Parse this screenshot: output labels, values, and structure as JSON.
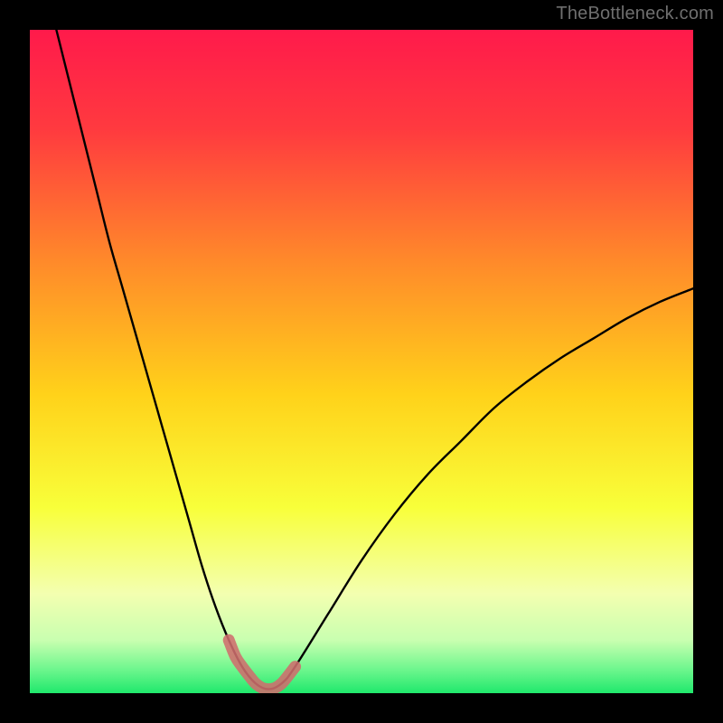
{
  "watermark": "TheBottleneck.com",
  "colors": {
    "bg": "#000000",
    "watermark": "#6f6f6f",
    "curve": "#000000",
    "marker": "#cf6d6d",
    "gradient_stops": [
      {
        "offset": 0.0,
        "color": "#ff1a4b"
      },
      {
        "offset": 0.15,
        "color": "#ff3a3f"
      },
      {
        "offset": 0.35,
        "color": "#ff8a2a"
      },
      {
        "offset": 0.55,
        "color": "#ffd21a"
      },
      {
        "offset": 0.72,
        "color": "#f8ff3a"
      },
      {
        "offset": 0.85,
        "color": "#f3ffb0"
      },
      {
        "offset": 0.92,
        "color": "#c9ffb0"
      },
      {
        "offset": 0.965,
        "color": "#6cf68d"
      },
      {
        "offset": 1.0,
        "color": "#1fe86c"
      }
    ]
  },
  "chart_data": {
    "type": "line",
    "title": "",
    "xlabel": "",
    "ylabel": "",
    "xlim": [
      0,
      100
    ],
    "ylim": [
      0,
      100
    ],
    "grid": false,
    "series": [
      {
        "name": "bottleneck-curve",
        "x": [
          4,
          6,
          8,
          10,
          12,
          14,
          16,
          18,
          20,
          22,
          24,
          26,
          28,
          30,
          32,
          34,
          36,
          38,
          40,
          45,
          50,
          55,
          60,
          65,
          70,
          75,
          80,
          85,
          90,
          95,
          100
        ],
        "y": [
          100,
          92,
          84,
          76,
          68,
          61,
          54,
          47,
          40,
          33,
          26,
          19,
          13,
          8,
          4,
          1.5,
          0.6,
          1.5,
          4,
          12,
          20,
          27,
          33,
          38,
          43,
          47,
          50.5,
          53.5,
          56.5,
          59,
          61
        ]
      }
    ],
    "highlight": {
      "name": "optimal-range",
      "x": [
        30,
        31,
        32,
        33,
        34,
        35,
        36,
        37,
        38,
        39,
        40
      ],
      "y": [
        8,
        5.5,
        4,
        2.7,
        1.5,
        0.8,
        0.6,
        0.8,
        1.5,
        2.7,
        4
      ]
    }
  }
}
